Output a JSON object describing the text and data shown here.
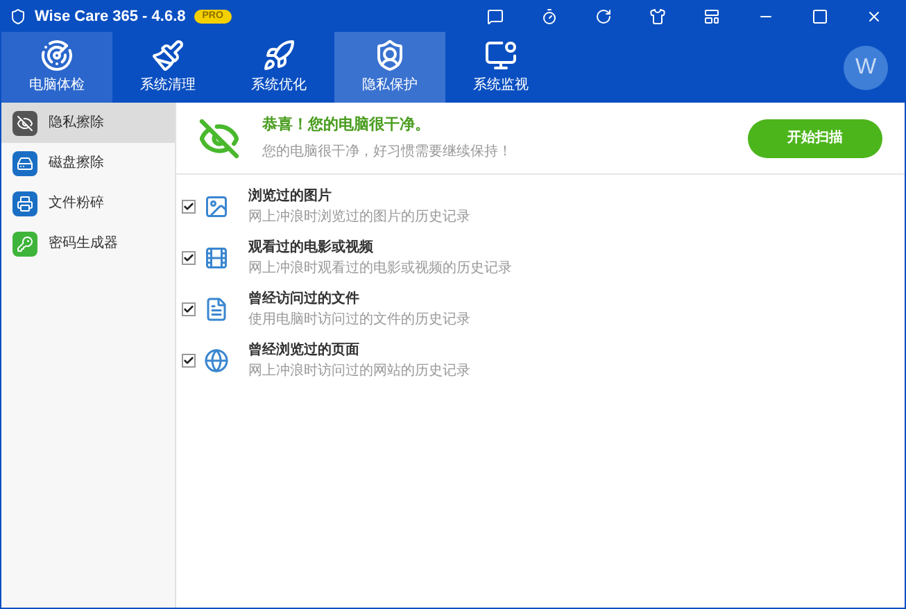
{
  "window": {
    "title": "Wise Care 365 - 4.6.8",
    "badge": "PRO"
  },
  "tabs": [
    {
      "label": "电脑体检",
      "selected": false,
      "highlighted": true
    },
    {
      "label": "系统清理",
      "selected": false,
      "highlighted": false
    },
    {
      "label": "系统优化",
      "selected": false,
      "highlighted": false
    },
    {
      "label": "隐私保护",
      "selected": true,
      "highlighted": false
    },
    {
      "label": "系统监视",
      "selected": false,
      "highlighted": false
    }
  ],
  "avatar": "W",
  "sidebar": {
    "items": [
      {
        "label": "隐私擦除",
        "selected": true,
        "kind": "eye"
      },
      {
        "label": "磁盘擦除",
        "selected": false,
        "kind": "disk"
      },
      {
        "label": "文件粉碎",
        "selected": false,
        "kind": "shredder"
      },
      {
        "label": "密码生成器",
        "selected": false,
        "kind": "key"
      }
    ]
  },
  "header": {
    "title": "恭喜！您的电脑很干净。",
    "subtitle": "您的电脑很干净，好习惯需要继续保持！",
    "button": "开始扫描"
  },
  "items": [
    {
      "title": "浏览过的图片",
      "description": "网上冲浪时浏览过的图片的历史记录",
      "checked": true,
      "kind": "image"
    },
    {
      "title": "观看过的电影或视频",
      "description": "网上冲浪时观看过的电影或视频的历史记录",
      "checked": true,
      "kind": "film"
    },
    {
      "title": "曾经访问过的文件",
      "description": "使用电脑时访问过的文件的历史记录",
      "checked": true,
      "kind": "document"
    },
    {
      "title": "曾经浏览过的页面",
      "description": "网上冲浪时访问过的网站的历史记录",
      "checked": true,
      "kind": "globe"
    }
  ]
}
